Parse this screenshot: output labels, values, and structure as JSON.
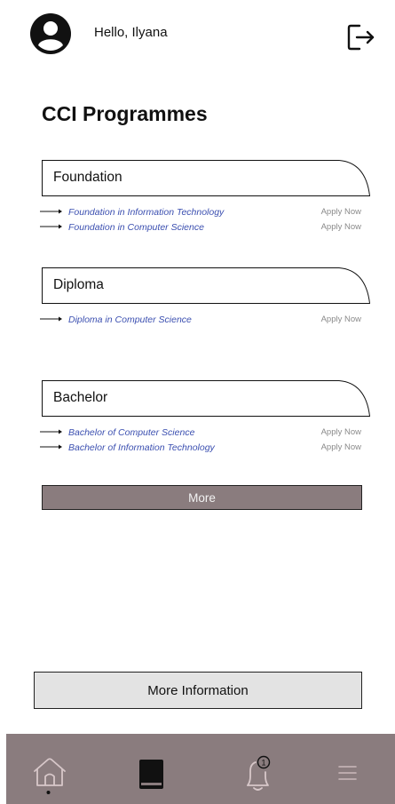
{
  "header": {
    "greeting": "Hello, Ilyana",
    "avatar_icon": "user-circle-icon",
    "logout_icon": "logout-icon"
  },
  "page_title": "CCI Programmes",
  "sections": [
    {
      "title": "Foundation",
      "programmes": [
        {
          "name": "Foundation in Information Technology",
          "action": "Apply Now"
        },
        {
          "name": "Foundation in Computer Science",
          "action": "Apply Now"
        }
      ]
    },
    {
      "title": "Diploma",
      "programmes": [
        {
          "name": "Diploma in Computer Science",
          "action": "Apply Now"
        }
      ]
    },
    {
      "title": "Bachelor",
      "programmes": [
        {
          "name": "Bachelor of Computer Science",
          "action": "Apply Now"
        },
        {
          "name": "Bachelor of Information Technology",
          "action": "Apply Now"
        }
      ]
    }
  ],
  "more_label": "More",
  "more_info_label": "More Information",
  "bottom_nav": {
    "items": [
      "home-icon",
      "book-icon",
      "notification-bell-icon",
      "menu-icon"
    ],
    "notification_count": "1"
  },
  "colors": {
    "accent": "#8a7c7e",
    "link": "#3b4fb0",
    "muted": "#8a8a8a",
    "nav_icon": "#cbb9bb"
  }
}
